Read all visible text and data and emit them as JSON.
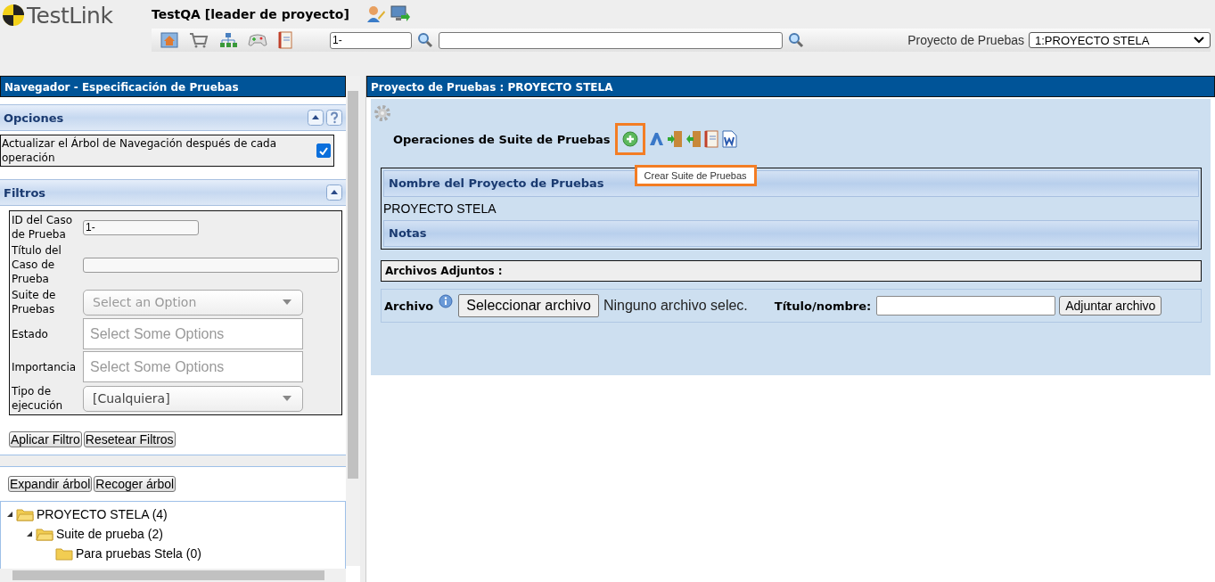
{
  "app": {
    "logo": "TestLink",
    "user": "TestQA [leader de proyecto]"
  },
  "toolbar": {
    "id_search": "1-",
    "project_label": "Proyecto de Pruebas",
    "project": "1:PROYECTO STELA"
  },
  "navigator": {
    "title": "Navegador - Especificación de Pruebas",
    "options": {
      "title": "Opciones",
      "refresh_label": "Actualizar el Árbol de Navegación después de cada operación",
      "refresh_checked": true
    },
    "filters": {
      "title": "Filtros",
      "fields": [
        {
          "label": "ID del Caso de Prueba",
          "kind": "text",
          "value": "1-"
        },
        {
          "label": "Título del Caso de Prueba",
          "kind": "text"
        },
        {
          "label": "Suite de Pruebas",
          "kind": "select",
          "placeholder": "Select an Option"
        },
        {
          "label": "Estado",
          "kind": "multi",
          "placeholder": "Select Some Options"
        },
        {
          "label": "Importancia",
          "kind": "multi",
          "placeholder": "Select Some Options"
        },
        {
          "label": "Tipo de ejecución",
          "kind": "select",
          "value": "[Cualquiera]"
        }
      ],
      "buttons": [
        "Aplicar Filtro",
        "Resetear Filtros"
      ]
    },
    "tree_buttons": [
      "Expandir árbol",
      "Recoger árbol"
    ],
    "tree": [
      {
        "label": "PROYECTO STELA (4)",
        "expanded": true,
        "children": [
          {
            "label": "Suite de prueba (2)",
            "expanded": true,
            "children": [
              {
                "label": "Para pruebas Stela (0)",
                "expanded": false
              }
            ]
          }
        ]
      }
    ]
  },
  "main": {
    "title": "Proyecto de Pruebas : PROYECTO STELA",
    "operations_label": "Operaciones de Suite de Pruebas",
    "tooltip": "Crear Suite de Pruebas",
    "name_header": "Nombre del Proyecto de Pruebas",
    "name": "PROYECTO STELA",
    "notes_header": "Notas",
    "attachments_title": "Archivos Adjuntos :",
    "file_label": "Archivo",
    "choose_button": "Seleccionar archivo",
    "no_file": "Ninguno archivo selec.",
    "title_label": "Título/nombre:",
    "attach_button": "Adjuntar archivo"
  }
}
